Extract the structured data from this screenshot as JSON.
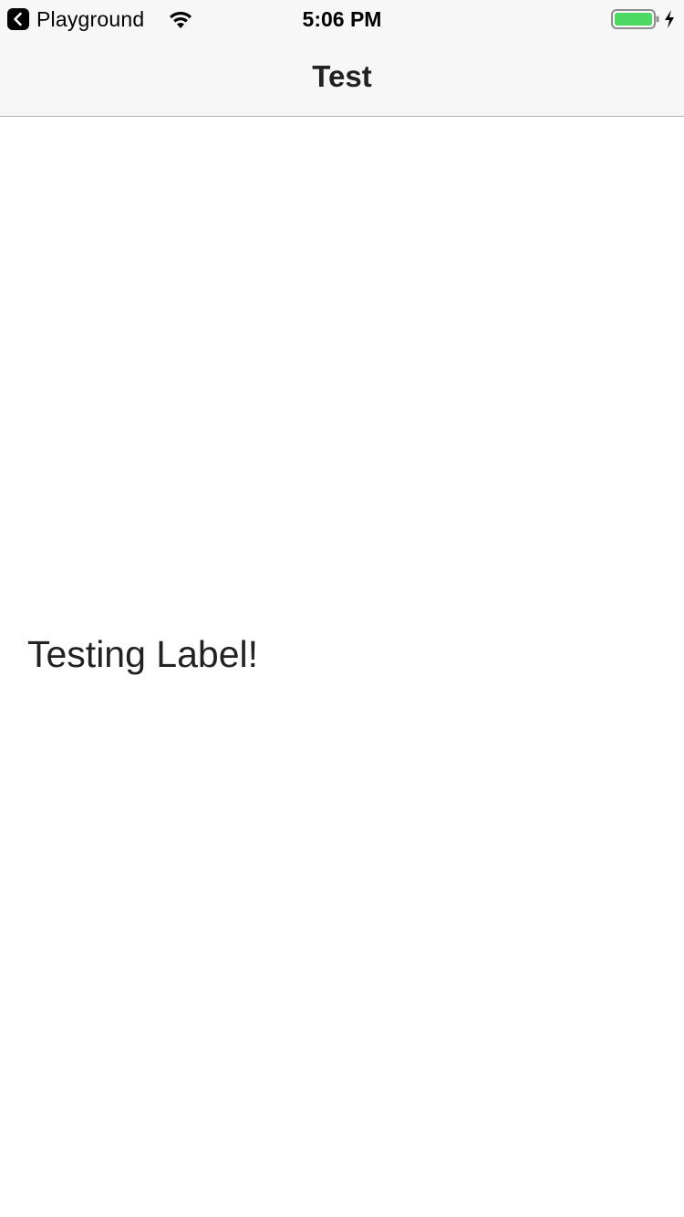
{
  "status_bar": {
    "back_app_label": "Playground",
    "time": "5:06 PM",
    "battery_level": 1.0,
    "charging": true,
    "icons": [
      "chevron-left-icon",
      "wifi-icon",
      "battery-icon",
      "charging-bolt-icon"
    ],
    "battery_color": "#4cd964"
  },
  "nav": {
    "title": "Test"
  },
  "content": {
    "label_text": "Testing Label!"
  }
}
